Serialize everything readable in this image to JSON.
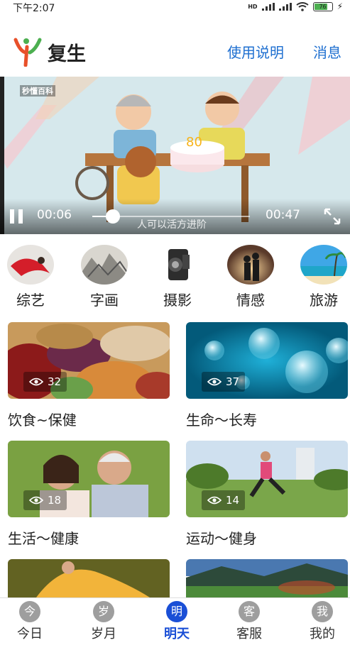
{
  "status": {
    "time": "下午2:07",
    "battery": "76",
    "hd": "HD"
  },
  "header": {
    "title": "复生",
    "manual": "使用说明",
    "messages": "消息"
  },
  "video": {
    "current": "00:06",
    "duration": "00:47",
    "watermark": "秒懂百科",
    "subtitle": "人可以活方进阶",
    "progress": 0.13
  },
  "categories": [
    {
      "label": "综艺"
    },
    {
      "label": "字画"
    },
    {
      "label": "摄影"
    },
    {
      "label": "情感"
    },
    {
      "label": "旅游"
    }
  ],
  "cards": [
    {
      "title": "饮食~保健",
      "views": "32"
    },
    {
      "title": "生命～长寿",
      "views": "37"
    },
    {
      "title": "生活～健康",
      "views": "18"
    },
    {
      "title": "运动～健身",
      "views": "14"
    }
  ],
  "tabs": [
    {
      "icon": "今",
      "label": "今日"
    },
    {
      "icon": "岁",
      "label": "岁月"
    },
    {
      "icon": "明",
      "label": "明天"
    },
    {
      "icon": "客",
      "label": "客服"
    },
    {
      "icon": "我",
      "label": "我的"
    }
  ],
  "colors": {
    "accent": "#1a4fd6",
    "link": "#1e6fd0"
  }
}
